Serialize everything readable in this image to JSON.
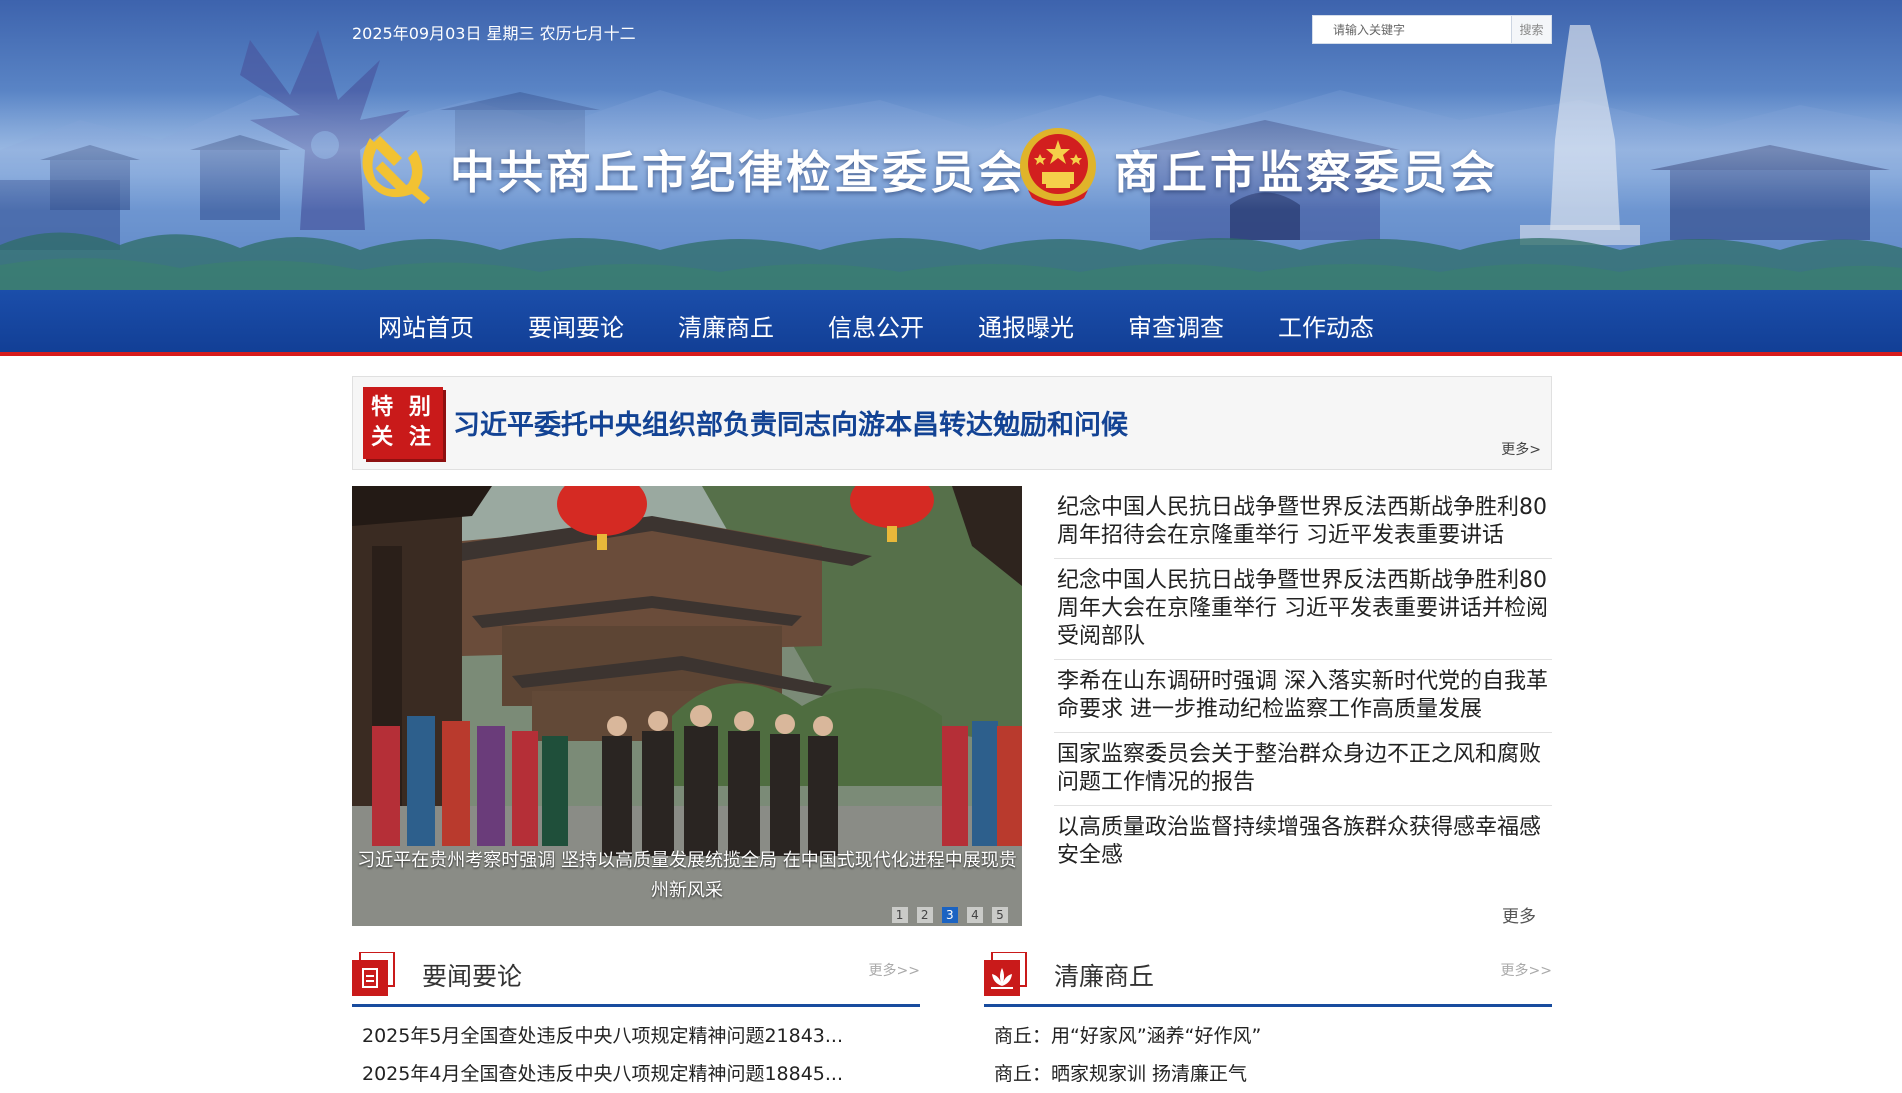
{
  "header": {
    "date": "2025年09月03日 星期三 农历七月十二",
    "search_placeholder": "请输入关键字",
    "search_button": "搜索",
    "title_left": "中共商丘市纪律检查委员会",
    "title_right": "商丘市监察委员会"
  },
  "nav": [
    {
      "label": "网站首页"
    },
    {
      "label": "要闻要论"
    },
    {
      "label": "清廉商丘"
    },
    {
      "label": "信息公开"
    },
    {
      "label": "通报曝光"
    },
    {
      "label": "审查调查"
    },
    {
      "label": "工作动态"
    }
  ],
  "focus": {
    "badge_line1": "特 别",
    "badge_line2": "关 注",
    "headline": "习近平委托中央组织部负责同志向游本昌转达勉励和问候",
    "more": "更多>"
  },
  "carousel": {
    "caption": "习近平在贵州考察时强调 坚持以高质量发展统揽全局 在中国式现代化进程中展现贵州新风采",
    "dots": [
      "1",
      "2",
      "3",
      "4",
      "5"
    ],
    "active_index": 3
  },
  "headlines": {
    "items": [
      "纪念中国人民抗日战争暨世界反法西斯战争胜利80周年招待会在京隆重举行 习近平发表重要讲话",
      "纪念中国人民抗日战争暨世界反法西斯战争胜利80周年大会在京隆重举行 习近平发表重要讲话并检阅受阅部队",
      "李希在山东调研时强调 深入落实新时代党的自我革命要求 进一步推动纪检监察工作高质量发展",
      "国家监察委员会关于整治群众身边不正之风和腐败问题工作情况的报告",
      "以高质量政治监督持续增强各族群众获得感幸福感安全感"
    ],
    "more": "更多"
  },
  "sections": {
    "news": {
      "title": "要闻要论",
      "more": "更多>>",
      "items": [
        "2025年5月全国查处违反中央八项规定精神问题21843...",
        "2025年4月全国查处违反中央八项规定精神问题18845..."
      ]
    },
    "clean": {
      "title": "清廉商丘",
      "more": "更多>>",
      "items": [
        "商丘：用“好家风”涵养“好作风”",
        "商丘：晒家规家训 扬清廉正气"
      ]
    }
  },
  "colors": {
    "nav_blue": "#1b4eaa",
    "accent_red": "#c91a1a",
    "headline_blue": "#134394"
  }
}
